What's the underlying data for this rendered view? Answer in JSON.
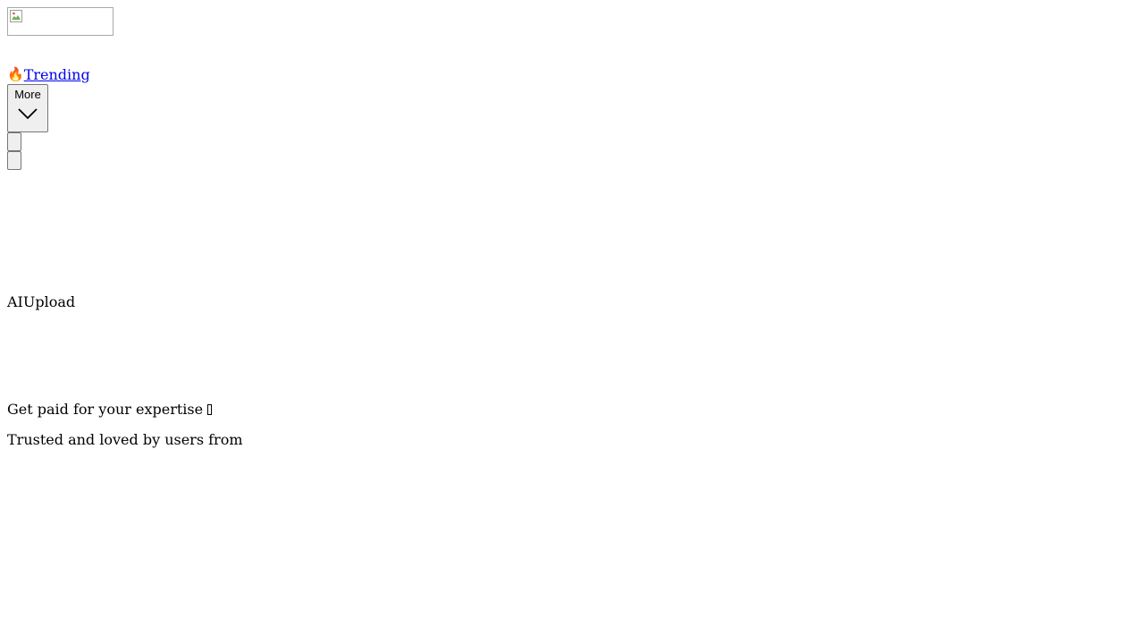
{
  "header": {
    "logo_icon": "broken-image-icon",
    "trending_icon": "fire-icon",
    "trending_emoji": "🔥",
    "trending_label": "Trending",
    "more_label": "More",
    "more_icon": "chevron-down-icon"
  },
  "hero": {
    "ai_text": "AI",
    "upload_text": "Upload",
    "get_paid_text": "Get paid for your expertise",
    "trusted_text": "Trusted and loved by users from"
  },
  "colors": {
    "link": "#0000ee",
    "button_bg": "#efefef",
    "button_border": "#767676"
  }
}
